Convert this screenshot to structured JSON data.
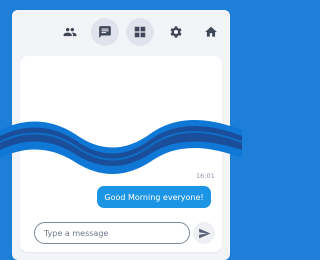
{
  "toolbar": {
    "buttons": [
      {
        "icon": "people-icon",
        "active": false
      },
      {
        "icon": "chat-icon",
        "active": true
      },
      {
        "icon": "grid-icon",
        "active": true
      },
      {
        "icon": "gear-icon",
        "active": false
      },
      {
        "icon": "home-icon",
        "active": false
      }
    ]
  },
  "chat": {
    "timestamp": "16:01",
    "message": "Good Morning everyone!"
  },
  "composer": {
    "placeholder": "Type a message",
    "send_icon": "send-icon"
  },
  "colors": {
    "background": "#1d7fd7",
    "accent": "#1d95e5",
    "wave_outer": "#0f77d6",
    "wave_inner": "#1a4e9a"
  }
}
